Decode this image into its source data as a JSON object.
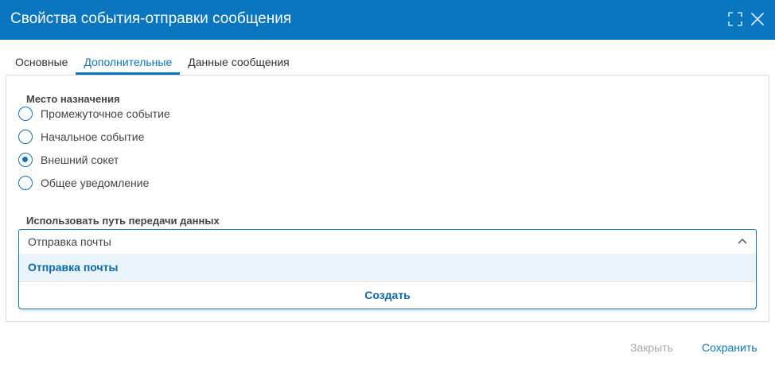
{
  "dialog": {
    "title": "Свойства события-отправки сообщения"
  },
  "titlebar_icons": [
    "maximize-icon",
    "close-icon"
  ],
  "tabs": [
    {
      "label": "Основные",
      "active": false
    },
    {
      "label": "Дополнительные",
      "active": true
    },
    {
      "label": "Данные сообщения",
      "active": false
    }
  ],
  "destination": {
    "label": "Место назначения",
    "options": [
      {
        "label": "Промежуточное событие",
        "checked": false
      },
      {
        "label": "Начальное событие",
        "checked": false
      },
      {
        "label": "Внешний сокет",
        "checked": true
      },
      {
        "label": "Общее уведомление",
        "checked": false
      }
    ]
  },
  "data_path": {
    "label": "Использовать путь передачи данных",
    "selected": "Отправка почты",
    "options": [
      "Отправка почты"
    ],
    "create_label": "Создать"
  },
  "footer": {
    "close_label": "Закрыть",
    "save_label": "Сохранить"
  },
  "colors": {
    "accent": "#0a76c0",
    "option_highlight": "#e9f4fb",
    "disabled_text": "#a9a9a9"
  }
}
